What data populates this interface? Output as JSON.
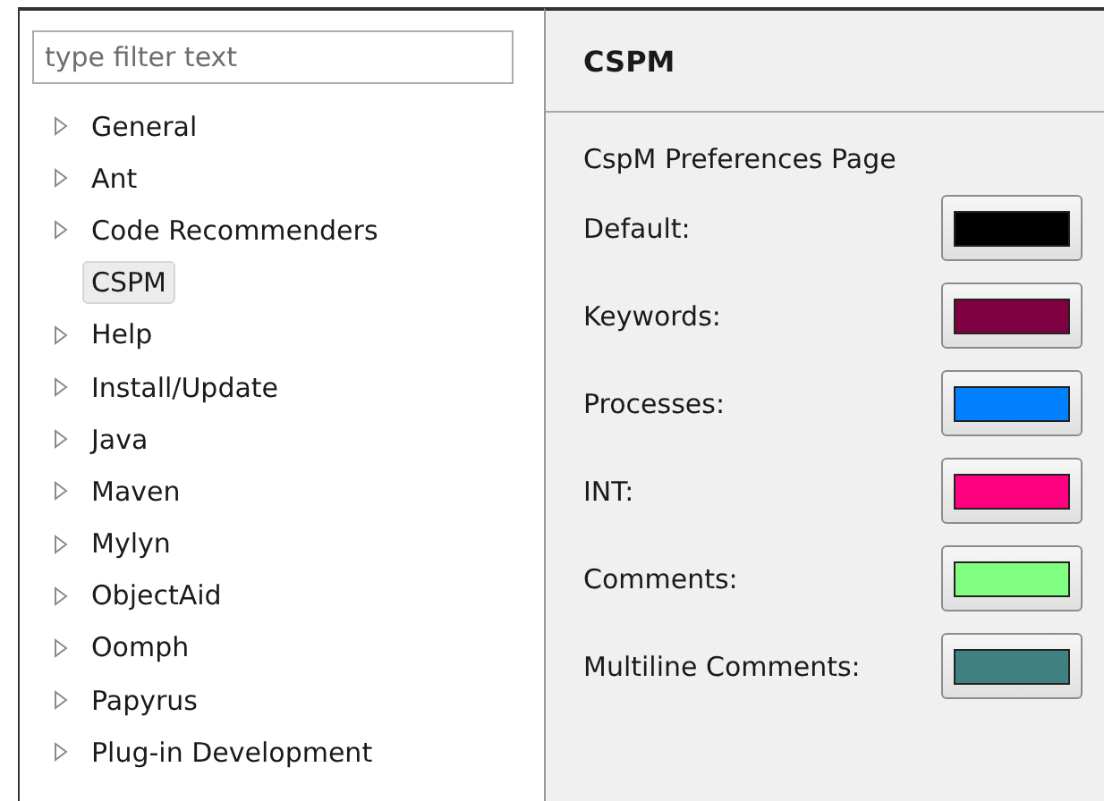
{
  "filter": {
    "placeholder": "type filter text"
  },
  "tree": [
    {
      "label": "General",
      "expandable": true,
      "selected": false
    },
    {
      "label": "Ant",
      "expandable": true,
      "selected": false
    },
    {
      "label": "Code Recommenders",
      "expandable": true,
      "selected": false
    },
    {
      "label": "CSPM",
      "expandable": false,
      "selected": true
    },
    {
      "label": "Help",
      "expandable": true,
      "selected": false
    },
    {
      "label": "Install/Update",
      "expandable": true,
      "selected": false
    },
    {
      "label": "Java",
      "expandable": true,
      "selected": false
    },
    {
      "label": "Maven",
      "expandable": true,
      "selected": false
    },
    {
      "label": "Mylyn",
      "expandable": true,
      "selected": false
    },
    {
      "label": "ObjectAid",
      "expandable": true,
      "selected": false
    },
    {
      "label": "Oomph",
      "expandable": true,
      "selected": false
    },
    {
      "label": "Papyrus",
      "expandable": true,
      "selected": false
    },
    {
      "label": "Plug-in Development",
      "expandable": true,
      "selected": false
    }
  ],
  "page": {
    "title": "CSPM",
    "description": "CspM Preferences Page",
    "colors": [
      {
        "label": "Default:",
        "color": "#000000"
      },
      {
        "label": "Keywords:",
        "color": "#7f0040"
      },
      {
        "label": "Processes:",
        "color": "#0080ff"
      },
      {
        "label": "INT:",
        "color": "#ff0080"
      },
      {
        "label": "Comments:",
        "color": "#80ff80"
      },
      {
        "label": "Multiline Comments:",
        "color": "#408080"
      }
    ]
  }
}
